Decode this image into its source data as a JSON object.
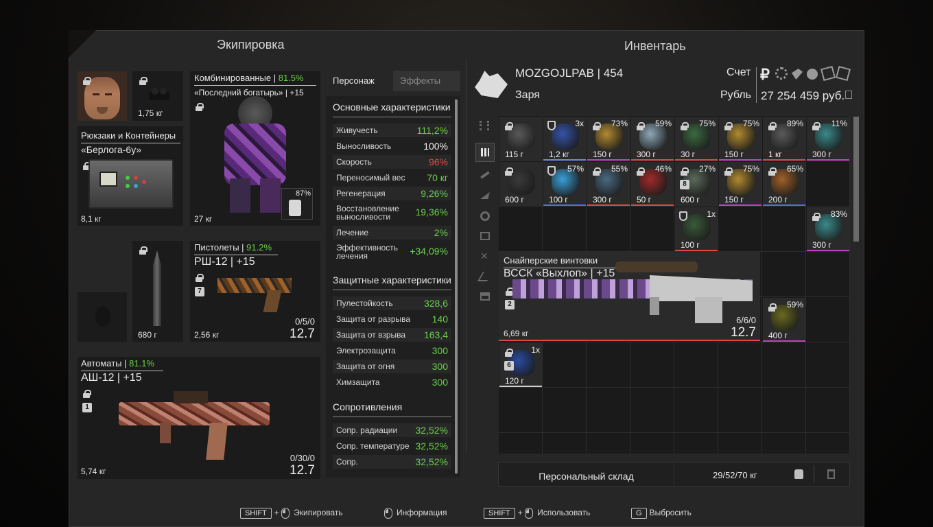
{
  "headers": {
    "equipment": "Экипировка",
    "inventory": "Инвентарь"
  },
  "equipment": {
    "face_weight": "",
    "nv_weight": "1,75 кг",
    "backpack": {
      "category": "Рюкзаки и Контейнеры",
      "name": "«Берлога-6у»",
      "weight": "8,1 кг"
    },
    "armor": {
      "category": "Комбинированные | ",
      "percent": "81.5%",
      "name": "«Последний богатырь» | +15",
      "weight": "27 кг",
      "sub_percent": "87%"
    },
    "knife": {
      "weight": "680 г"
    },
    "pistol": {
      "category": "Пистолеты | ",
      "percent": "91.2%",
      "name": "РШ-12 | +15",
      "badge": "7",
      "weight": "2,56 кг",
      "ammo": "0/5/0",
      "caliber": "12.7"
    },
    "rifle": {
      "category": "Автоматы | ",
      "percent": "81.1%",
      "name": "АШ-12 | +15",
      "badge": "1",
      "weight": "5,74 кг",
      "ammo": "0/30/0",
      "caliber": "12.7"
    }
  },
  "stats": {
    "tabs": [
      "Персонаж",
      "Эффекты"
    ],
    "main_title": "Основные характеристики",
    "main": [
      {
        "k": "Живучесть",
        "v": "111,2%",
        "c": "g"
      },
      {
        "k": "Выносливость",
        "v": "100%",
        "c": "w"
      },
      {
        "k": "Скорость",
        "v": "96%",
        "c": "r"
      },
      {
        "k": "Переносимый вес",
        "v": "70 кг",
        "c": "g"
      },
      {
        "k": "Регенерация",
        "v": "9,26%",
        "c": "g"
      },
      {
        "k": "Восстановление выносливости",
        "v": "19,36%",
        "c": "g"
      },
      {
        "k": "Лечение",
        "v": "2%",
        "c": "g"
      },
      {
        "k": "Эффективность лечения",
        "v": "+34,09%",
        "c": "g"
      }
    ],
    "def_title": "Защитные характеристики",
    "def": [
      {
        "k": "Пулестойкость",
        "v": "328,6",
        "c": "g"
      },
      {
        "k": "Защита от разрыва",
        "v": "140",
        "c": "g"
      },
      {
        "k": "Защита от взрыва",
        "v": "163,4",
        "c": "g"
      },
      {
        "k": "Электрозащита",
        "v": "300",
        "c": "g"
      },
      {
        "k": "Защита от огня",
        "v": "300",
        "c": "g"
      },
      {
        "k": "Химзащита",
        "v": "300",
        "c": "g"
      }
    ],
    "res_title": "Сопротивления",
    "res": [
      {
        "k": "Сопр. радиации",
        "v": "32,52%",
        "c": "g"
      },
      {
        "k": "Сопр. температуре",
        "v": "32,52%",
        "c": "g"
      },
      {
        "k": "Сопр.",
        "v": "32,52%",
        "c": "g"
      }
    ]
  },
  "player": {
    "name": "MOZGOJLPAB | 454",
    "faction": "Заря",
    "account_label": "Счет",
    "currency_label": "Рубль",
    "money": "27 254 459 руб."
  },
  "inventory": {
    "items": [
      {
        "col": 0,
        "row": 0,
        "pct": "",
        "w": "115 г",
        "lock": true,
        "color": "#5a5a5a",
        "bar": ""
      },
      {
        "col": 1,
        "row": 0,
        "pct": "3x",
        "w": "1,2 кг",
        "lock": false,
        "color": "#3553a8",
        "bar": "#6a8ae0"
      },
      {
        "col": 2,
        "row": 0,
        "pct": "73%",
        "w": "150 г",
        "lock": true,
        "color": "#b08a30",
        "bar": "#c040c0"
      },
      {
        "col": 3,
        "row": 0,
        "pct": "59%",
        "w": "300 г",
        "lock": true,
        "color": "#8fa8b8",
        "bar": "#e04848"
      },
      {
        "col": 4,
        "row": 0,
        "pct": "75%",
        "w": "30 г",
        "lock": true,
        "color": "#3c6a40",
        "bar": "#e04848"
      },
      {
        "col": 5,
        "row": 0,
        "pct": "75%",
        "w": "150 г",
        "lock": true,
        "color": "#b08a30",
        "bar": "#c040c0"
      },
      {
        "col": 6,
        "row": 0,
        "pct": "89%",
        "w": "1 кг",
        "lock": true,
        "color": "#5a5a5a",
        "bar": "#e04848"
      },
      {
        "col": 7,
        "row": 0,
        "pct": "11%",
        "w": "300 г",
        "lock": true,
        "color": "#3a8a8a",
        "bar": "#c040c0"
      },
      {
        "col": 0,
        "row": 1,
        "pct": "",
        "w": "600 г",
        "lock": true,
        "color": "#3a3a3a",
        "bar": ""
      },
      {
        "col": 1,
        "row": 1,
        "pct": "57%",
        "w": "100 г",
        "lock": false,
        "color": "#3aa0d8",
        "bar": "#5a6ae0"
      },
      {
        "col": 2,
        "row": 1,
        "pct": "55%",
        "w": "300 г",
        "lock": true,
        "color": "#4a6a80",
        "bar": "#e04848"
      },
      {
        "col": 3,
        "row": 1,
        "pct": "46%",
        "w": "50 г",
        "lock": true,
        "color": "#a02a2a",
        "bar": "#e04848"
      },
      {
        "col": 4,
        "row": 1,
        "pct": "27%",
        "w": "600 г",
        "lock": true,
        "color": "#5a6a5a",
        "bar": "",
        "badge": "8"
      },
      {
        "col": 5,
        "row": 1,
        "pct": "75%",
        "w": "150 г",
        "lock": true,
        "color": "#b08a30",
        "bar": "#c040c0"
      },
      {
        "col": 6,
        "row": 1,
        "pct": "65%",
        "w": "200 г",
        "lock": true,
        "color": "#a0602a",
        "bar": "#5a6ae0"
      },
      {
        "col": 4,
        "row": 2,
        "pct": "1x",
        "w": "100 г",
        "lock": false,
        "color": "#3a5a3a",
        "bar": "#e04848"
      },
      {
        "col": 7,
        "row": 2,
        "pct": "83%",
        "w": "300 г",
        "lock": true,
        "color": "#3a8a8a",
        "bar": "#c040c0"
      },
      {
        "col": 6,
        "row": 4,
        "pct": "59%",
        "w": "400 г",
        "lock": true,
        "color": "#6a6a20",
        "bar": "#c040c0"
      },
      {
        "col": 0,
        "row": 5,
        "pct": "1x",
        "w": "120 г",
        "lock": true,
        "color": "#2a4aa0",
        "bar": "#d0d0d0",
        "badge": "6"
      }
    ],
    "sniper": {
      "category": "Снайперские винтовки",
      "name": "ВССК «Выхлоп» | +15",
      "badge": "2",
      "weight": "6,69 кг",
      "ammo": "6/6/0",
      "caliber": "12.7"
    },
    "storage_label": "Персональный склад",
    "weight_summary": "29/52/70 кг"
  },
  "hints": [
    {
      "key": "SHIFT",
      "label": "Экипировать"
    },
    {
      "key": "",
      "label": "Информация"
    },
    {
      "key": "SHIFT",
      "label": "Использовать"
    },
    {
      "key": "G",
      "label": "Выбросить"
    }
  ],
  "colors": {
    "green": "#6ad04a",
    "red": "#e24848",
    "panel": "#262626"
  }
}
